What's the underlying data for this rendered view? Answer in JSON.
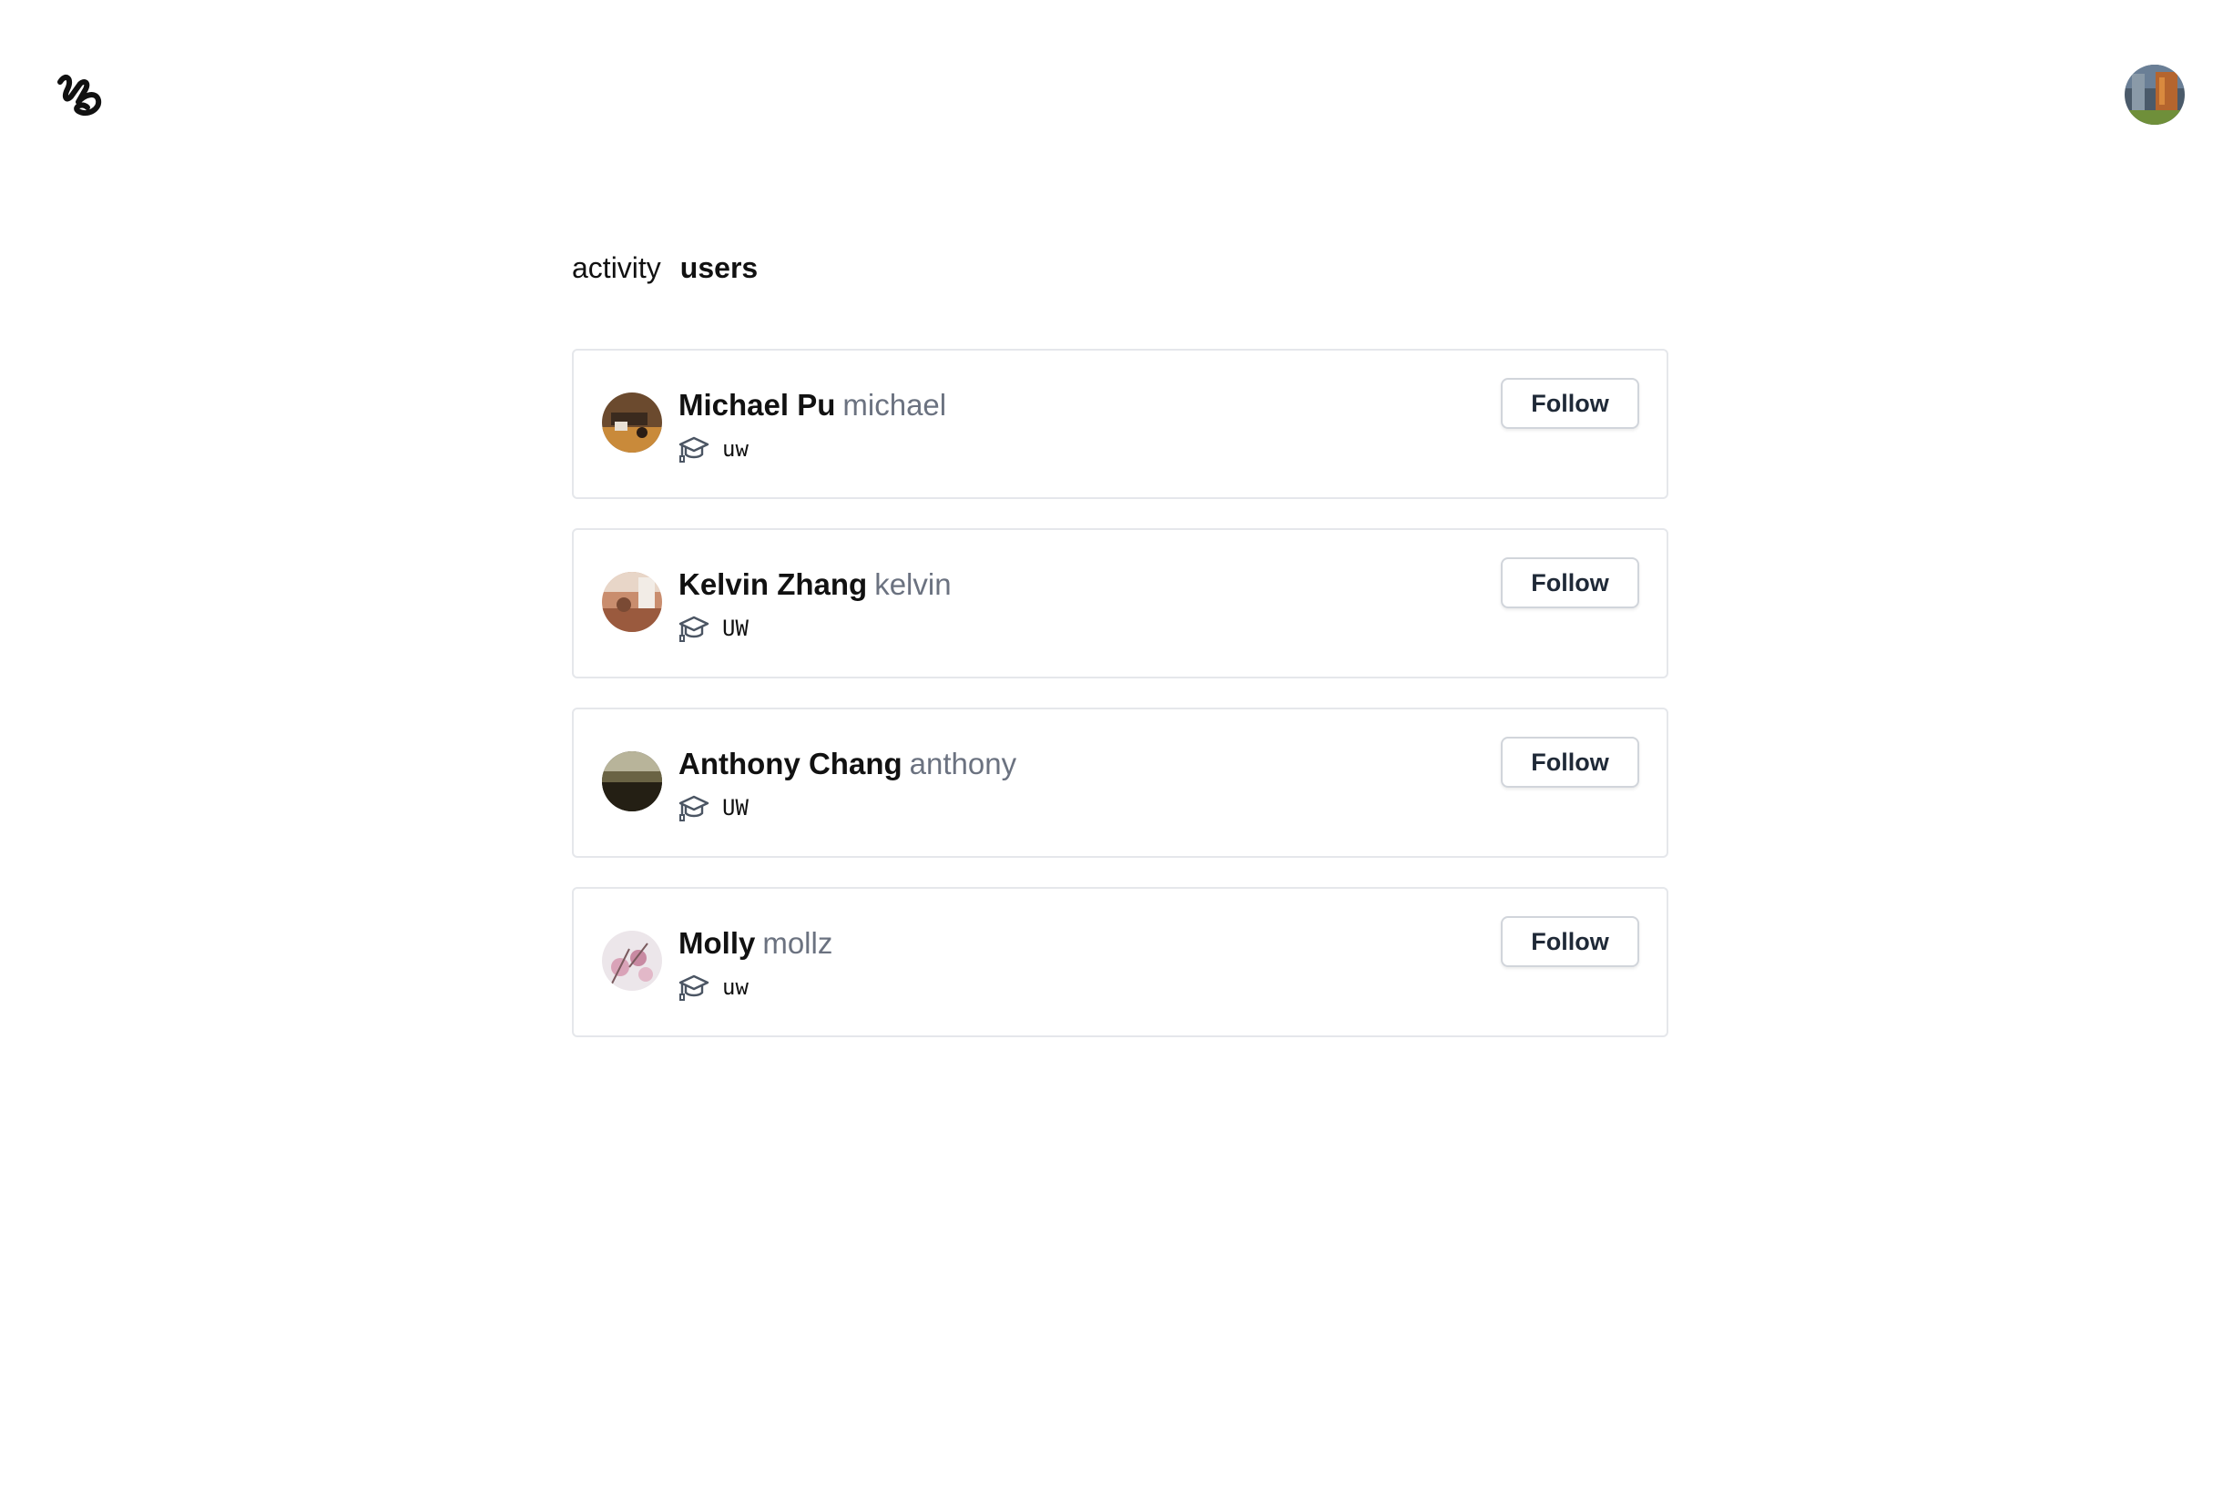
{
  "header": {
    "logo_icon": "squiggle-logo-icon",
    "profile_icon": "profile-avatar-icon"
  },
  "tabs": [
    {
      "label": "activity",
      "active": false
    },
    {
      "label": "users",
      "active": true
    }
  ],
  "users": [
    {
      "display_name": "Michael Pu",
      "username": "michael",
      "school": "uw",
      "follow_label": "Follow"
    },
    {
      "display_name": "Kelvin Zhang",
      "username": "kelvin",
      "school": "UW",
      "follow_label": "Follow"
    },
    {
      "display_name": "Anthony Chang",
      "username": "anthony",
      "school": "UW",
      "follow_label": "Follow"
    },
    {
      "display_name": "Molly",
      "username": "mollz",
      "school": "uw",
      "follow_label": "Follow"
    }
  ],
  "icons": {
    "school": "graduation-cap-icon"
  }
}
